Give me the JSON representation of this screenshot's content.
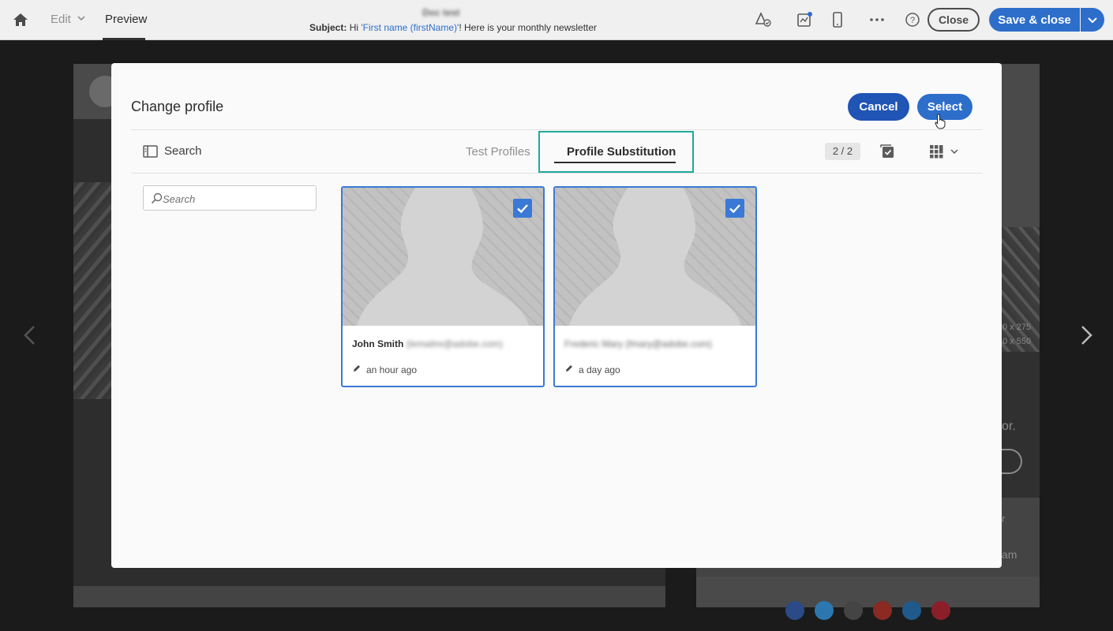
{
  "topbar": {
    "edit_label": "Edit",
    "preview_label": "Preview",
    "doc_title": "Doc test",
    "subject_label": "Subject:",
    "subject_prefix": "Hi",
    "subject_token": "'First name (firstName)'",
    "subject_suffix": "! Here is your monthly newsletter",
    "close_label": "Close",
    "save_label": "Save & close"
  },
  "background": {
    "dim_text_1": "0 x 275",
    "dim_text_2": "0 x 550",
    "snippet_1": "or.",
    "snippet_2": "r",
    "snippet_3": "am"
  },
  "modal": {
    "title": "Change profile",
    "cancel_label": "Cancel",
    "select_label": "Select",
    "search_toggle_label": "Search",
    "tabs": [
      {
        "label": "Test Profiles",
        "active": false
      },
      {
        "label": "Profile Substitution",
        "active": true
      }
    ],
    "count": "2 / 2",
    "search_placeholder": "Search"
  },
  "cards": [
    {
      "name": "John Smith",
      "email": "(lemaitre@adobe.com)",
      "time": "an hour ago",
      "checked": true
    },
    {
      "name": "",
      "name_blurred": "Frederic Mary (fmary@adobe.com)",
      "time": "a day ago",
      "checked": true
    }
  ],
  "colors": {
    "accent": "#2d6ecb",
    "cancel": "#2054b5",
    "highlight": "#20a99c",
    "card_border": "#3a7ad6"
  }
}
